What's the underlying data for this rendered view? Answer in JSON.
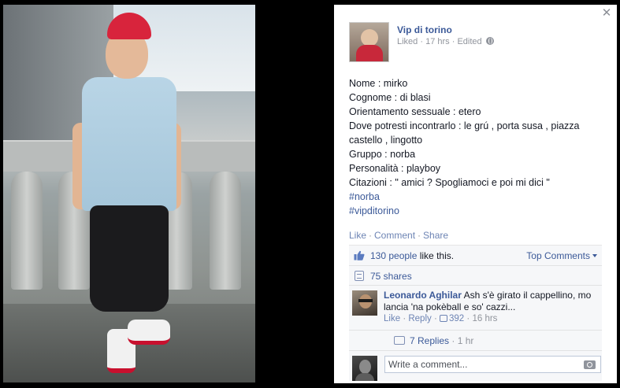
{
  "post": {
    "page_name": "Vip di torino",
    "meta_liked": "Liked",
    "meta_dot": "·",
    "meta_time": "17 hrs",
    "meta_edited": "Edited",
    "lines": [
      "Nome : mirko",
      "Cognome : di blasi",
      "Orientamento sessuale : etero",
      "Dove potresti incontrarlo : le grú , porta susa , piazza",
      "castello , lingotto",
      "Gruppo : norba",
      "Personalità : playboy",
      "Citazioni : \" amici ? Spogliamoci e poi mi dici \""
    ],
    "hashtags": [
      "#norba",
      "#vipditorino"
    ]
  },
  "actions": {
    "like": "Like",
    "comment": "Comment",
    "share": "Share",
    "sep": "·"
  },
  "ufi": {
    "likes_link": "130 people",
    "likes_suffix": " like this.",
    "top_comments": "Top Comments",
    "shares": "75 shares",
    "comment": {
      "author": "Leonardo Aghilar",
      "text": "Ash s'è girato il cappellino, mo lancia 'na pokèball e so' cazzi...",
      "like": "Like",
      "reply": "Reply",
      "likes_count": "392",
      "time": "16 hrs",
      "sep": "·"
    },
    "replies": {
      "label": "7 Replies",
      "time": "1 hr",
      "sep": "·"
    },
    "compose_placeholder": "Write a comment..."
  },
  "icons": {
    "close": "close-icon",
    "globe": "globe-icon",
    "like": "thumbs-up-icon",
    "share": "share-icon",
    "reply": "reply-icon",
    "camera": "camera-icon"
  },
  "colors": {
    "link": "#3b5998",
    "muted": "#90949c",
    "ufi_bg": "#f6f7f9"
  }
}
